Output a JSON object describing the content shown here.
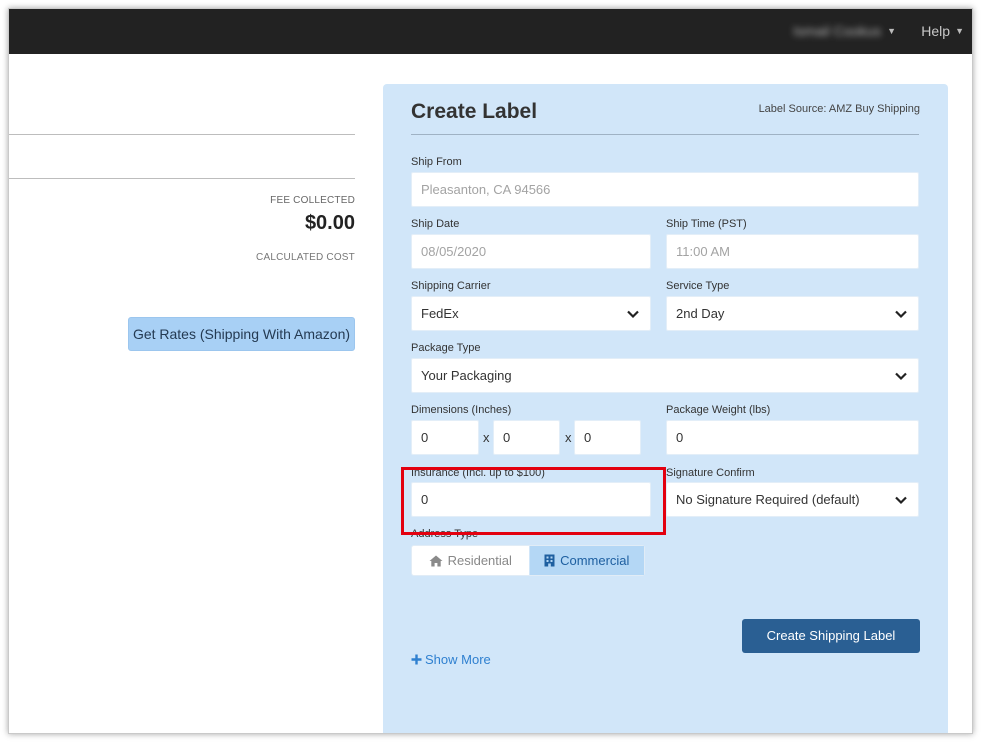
{
  "topbar": {
    "user_name": "Ismail Cookus",
    "help_label": "Help"
  },
  "summary": {
    "fee_collected_label": "FEE COLLECTED",
    "fee_collected_value": "$0.00",
    "calculated_cost_label": "CALCULATED COST",
    "get_rates_button": "Get Rates (Shipping With Amazon)"
  },
  "create_label": {
    "title": "Create Label",
    "label_source": "Label Source: AMZ Buy Shipping",
    "ship_from": {
      "label": "Ship From",
      "value": "Pleasanton, CA 94566"
    },
    "ship_date": {
      "label": "Ship Date",
      "value": "08/05/2020"
    },
    "ship_time": {
      "label": "Ship Time (PST)",
      "value": "11:00 AM"
    },
    "shipping_carrier": {
      "label": "Shipping Carrier",
      "value": "FedEx"
    },
    "service_type": {
      "label": "Service Type",
      "value": "2nd Day"
    },
    "package_type": {
      "label": "Package Type",
      "value": "Your Packaging"
    },
    "dimensions": {
      "label": "Dimensions (Inches)",
      "length": "0",
      "width": "0",
      "height": "0",
      "separator": "x"
    },
    "package_weight": {
      "label": "Package Weight (lbs)",
      "value": "0"
    },
    "insurance": {
      "label": "Insurance (Incl. up to $100)",
      "value": "0"
    },
    "signature_confirm": {
      "label": "Signature Confirm",
      "value": "No Signature Required (default)"
    },
    "address_type": {
      "label": "Address Type",
      "residential": "Residential",
      "commercial": "Commercial",
      "selected": "Commercial"
    },
    "create_button": "Create Shipping Label",
    "show_more": "Show More"
  },
  "colors": {
    "topbar": "#222222",
    "panel": "#d1e6f9",
    "primary_button": "#2a5f93",
    "secondary_button": "#a8d0f5",
    "highlight": "#e3000f",
    "link": "#2f80d0"
  },
  "icons": {
    "user_caret": "caret-down-icon",
    "help_caret": "caret-down-icon",
    "select_chevron": "chevron-down-icon",
    "residential": "home-icon",
    "commercial": "building-icon",
    "show_more": "plus-icon"
  }
}
